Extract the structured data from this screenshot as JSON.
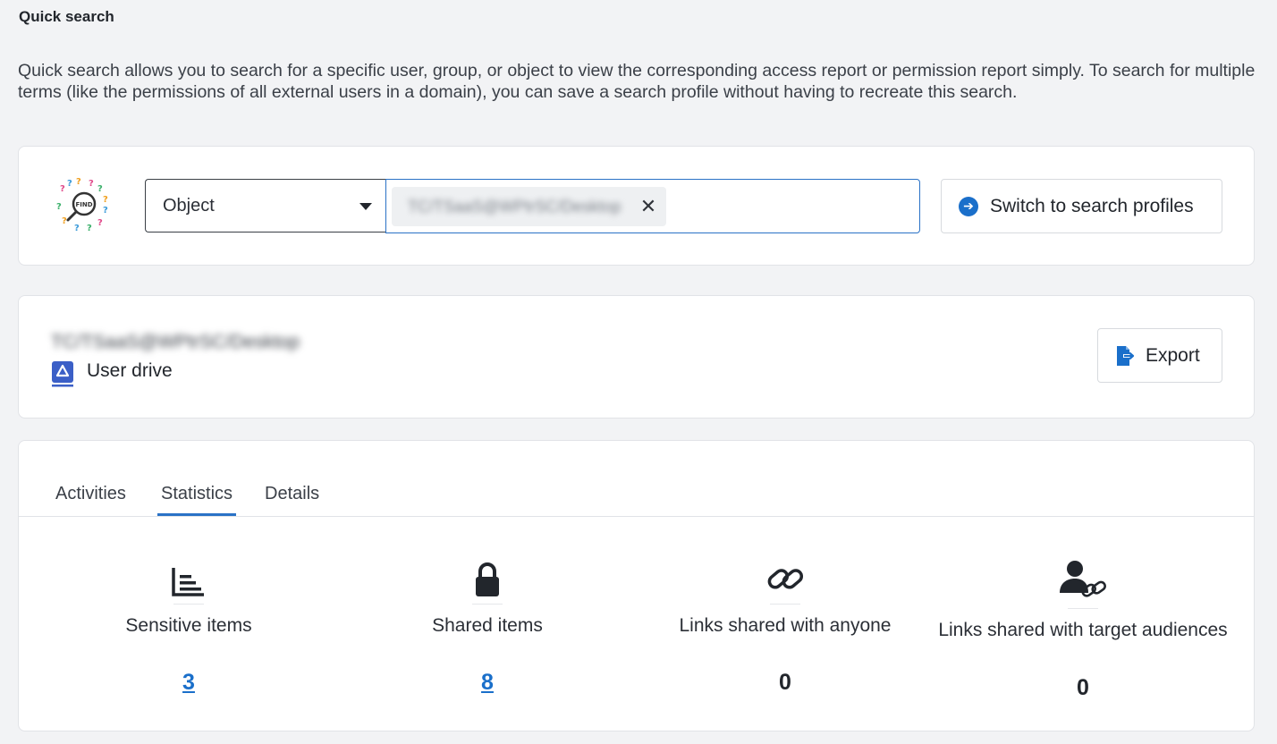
{
  "page": {
    "title": "Quick search",
    "intro": "Quick search allows you to search for a specific user, group, or object to view the corresponding access report or permission report simply. To search for multiple terms (like the permissions of all external users in a domain), you can save a search profile without having to recreate this search."
  },
  "search": {
    "type_value": "Object",
    "chip_value": "TC/TSaaS@WPtrSC/Desktop",
    "switch_label": "Switch to search profiles",
    "icons": {
      "find": "find-magnifier-icon",
      "switch": "arrow-circle-right-icon",
      "chip_remove": "close-icon",
      "caret": "caret-down-icon"
    }
  },
  "object": {
    "name": "TC/TSaaS@WPtrSC/Desktop",
    "type": "User drive",
    "export_label": "Export",
    "icons": {
      "drive": "google-drive-icon",
      "export": "file-export-icon"
    }
  },
  "tabs": [
    {
      "label": "Activities",
      "active": false
    },
    {
      "label": "Statistics",
      "active": true
    },
    {
      "label": "Details",
      "active": false
    }
  ],
  "stats": [
    {
      "label": "Sensitive items",
      "value": "3",
      "link": true,
      "icon": "list-chart-icon"
    },
    {
      "label": "Shared items",
      "value": "8",
      "link": true,
      "icon": "lock-icon"
    },
    {
      "label": "Links shared with anyone",
      "value": "0",
      "link": false,
      "icon": "link-icon"
    },
    {
      "label": "Links shared with target audiences",
      "value": "0",
      "link": false,
      "icon": "user-link-icon"
    }
  ],
  "colors": {
    "accent": "#1a6fca",
    "text": "#22262c",
    "background": "#f2f3f5"
  }
}
